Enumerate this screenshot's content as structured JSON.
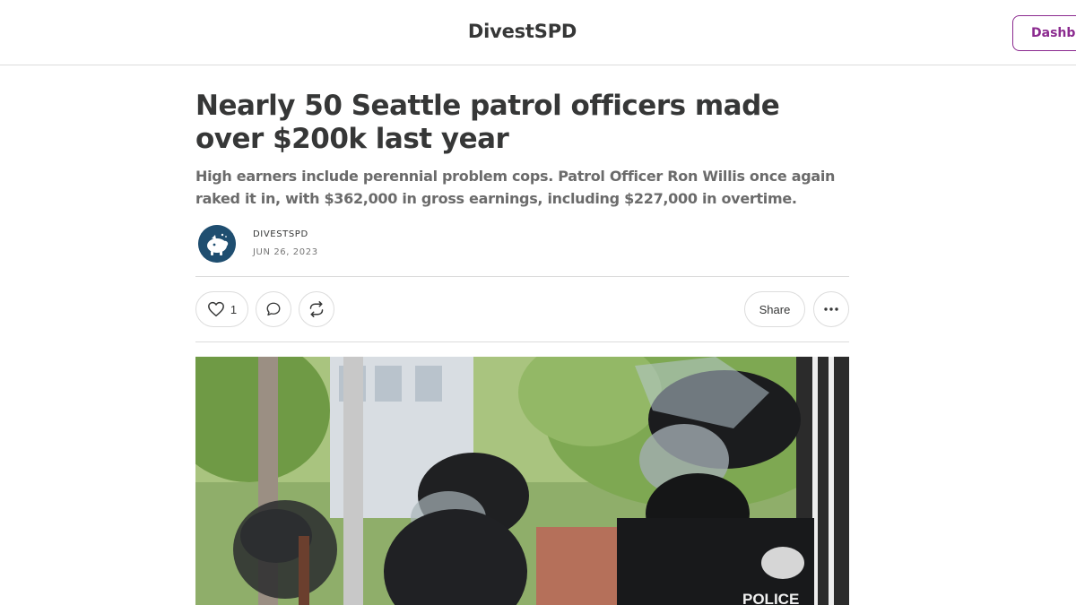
{
  "header": {
    "publication_name": "DivestSPD",
    "dashboard_label": "Dashboard"
  },
  "post": {
    "title": "Nearly 50 Seattle patrol officers made over $200k last year",
    "subtitle": "High earners include perennial problem cops. Patrol Officer Ron Willis once again raked it in, with $362,000 in gross earnings, including $227,000 in overtime.",
    "author": "DIVESTSPD",
    "date": "JUN 26, 2023",
    "like_count": "1",
    "share_label": "Share",
    "hero_text": "POLICE"
  },
  "icons": {
    "like": "heart-icon",
    "comment": "comment-bubble-icon",
    "restack": "restack-icon",
    "more": "ellipsis-icon"
  },
  "colors": {
    "accent": "#8b2a8f",
    "text": "#363737",
    "muted": "#6b6b6b",
    "border": "#dcdcdc",
    "avatar_bg": "#1f4e70"
  }
}
